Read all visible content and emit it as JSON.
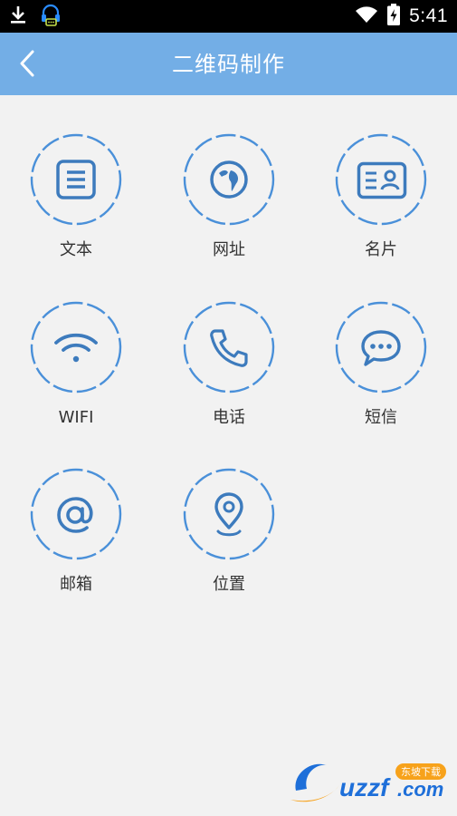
{
  "status_bar": {
    "time": "5:41",
    "icons": [
      "download-icon",
      "headset-notification-icon",
      "wifi-icon",
      "battery-charging-icon"
    ]
  },
  "header": {
    "title": "二维码制作",
    "back_icon": "chevron-left-icon"
  },
  "theme": {
    "header_bg": "#73aee6",
    "icon_color": "#3d7bbd",
    "ring_color": "#4a90d9",
    "label_color": "#333333",
    "page_bg": "#f2f2f2"
  },
  "items": [
    {
      "label": "文本",
      "icon": "text-document-icon"
    },
    {
      "label": "网址",
      "icon": "globe-icon"
    },
    {
      "label": "名片",
      "icon": "business-card-icon"
    },
    {
      "label": "WIFI",
      "icon": "wifi-icon"
    },
    {
      "label": "电话",
      "icon": "phone-icon"
    },
    {
      "label": "短信",
      "icon": "chat-bubble-icon"
    },
    {
      "label": "邮箱",
      "icon": "at-sign-icon"
    },
    {
      "label": "位置",
      "icon": "location-pin-icon"
    }
  ],
  "watermark": {
    "brand": "uzzf.com",
    "tag": "东坡下载"
  }
}
